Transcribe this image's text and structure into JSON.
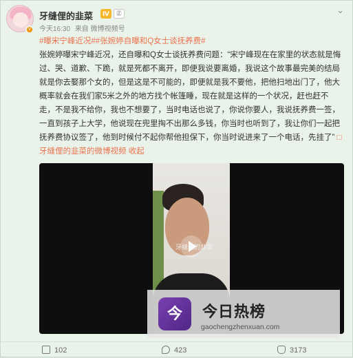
{
  "post": {
    "author": "牙缝俚的韭菜",
    "vip_badge": "Ⅳ",
    "rank_badge": "㊣",
    "time": "今天16:30",
    "source": "来自 微博视频号",
    "topic1": "#曝宋宁峰近况#",
    "topic2": "#张婉婷自曝和Q女士谈抚养费#",
    "text": "张婉婷曝宋宁峰近况，还自曝和Q女士谈抚养费问题：“宋宁峰现在在家里的状态就是悔过、哭、道歉、下跪，就是死都不离开，即便我说要离婚，我说这个故事最完美的结局就是你去娶那个女的，但是这是不可能的，即便就是我不要他，把他扫地出门了，他大概率就会在我们家5米之外的地方找个帐篷睡，现在就是这样的一个状况，赶也赶不走，不是我不给你，我也不想要了，当时电话也说了，你说你要人，我说抚养费一签，一直到孩子上大学，他说现在兜里掏不出那么多钱，你当时也听到了，我让你们一起把抚养费协议签了，他到时候付不起你帮他担保下，你当时说进来了一个电话，先挂了”",
    "link_text": "□牙缝俚的韭菜的微博视频",
    "collapse": "收起",
    "video_caption": "牙缝俚的韭菜"
  },
  "watermark": {
    "logo": "今",
    "title": "今日热榜",
    "url": "gaochengzhenxuan.com"
  },
  "stats": {
    "shares": "102",
    "comments": "423",
    "likes": "3173"
  },
  "icons": [
    "more-icon",
    "share-icon",
    "comment-icon",
    "like-icon",
    "play-icon"
  ]
}
